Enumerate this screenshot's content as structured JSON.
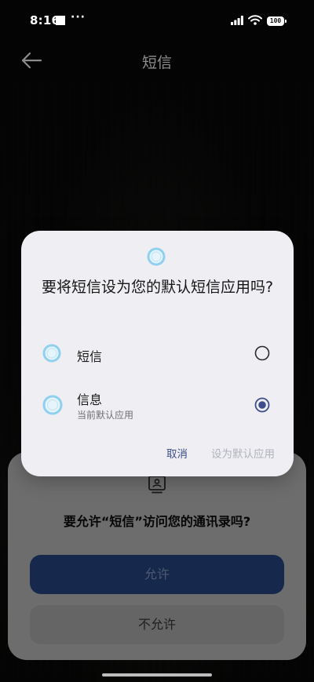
{
  "status_bar": {
    "time": "8:16",
    "dots": "···",
    "battery": "100"
  },
  "app_bar": {
    "title": "短信"
  },
  "permission_sheet": {
    "question": "要允许“短信”访问您的通讯录吗?",
    "allow_label": "允许",
    "deny_label": "不允许"
  },
  "dialog": {
    "title": "要将短信设为您的默认短信应用吗?",
    "options": [
      {
        "name": "短信",
        "subtitle": "",
        "selected": false
      },
      {
        "name": "信息",
        "subtitle": "当前默认应用",
        "selected": true
      }
    ],
    "cancel_label": "取消",
    "set_default_label": "设为默认应用"
  },
  "colors": {
    "accent": "#3d4e8a",
    "dialog_bg": "#efeef3",
    "allow_button": "#2a4a8c",
    "app_icon_ring": "#8fd0ef"
  },
  "icons": {
    "back": "arrow-left-icon",
    "contacts": "contacts-icon",
    "app_icon": "ring-app-icon"
  }
}
